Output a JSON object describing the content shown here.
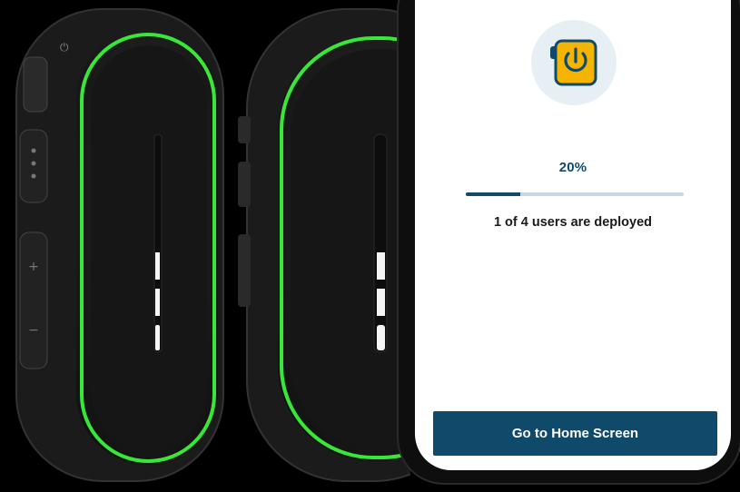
{
  "screen": {
    "app_icon": "power-button-icon",
    "progress": {
      "percent_label": "20%",
      "value": 0.25
    },
    "status_text": "1 of 4 users are deployed",
    "home_button_label": "Go to Home Screen"
  },
  "colors": {
    "primary": "#0f4a6b",
    "track": "#c9d6e4",
    "icon_fill": "#f5b400",
    "icon_bg": "#e6f0f4",
    "led_green": "#3cff3c"
  }
}
